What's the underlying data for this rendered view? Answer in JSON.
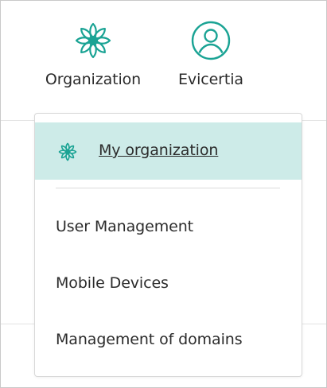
{
  "header": {
    "items": [
      {
        "label": "Organization",
        "icon": "lotus-icon"
      },
      {
        "label": "Evicertia",
        "icon": "user-circle-icon"
      }
    ]
  },
  "dropdown": {
    "highlighted": {
      "label": "My organization",
      "icon": "lotus-icon"
    },
    "items": [
      {
        "label": "User Management"
      },
      {
        "label": "Mobile Devices"
      },
      {
        "label": "Management of domains"
      }
    ]
  },
  "colors": {
    "accent": "#1aa394",
    "highlight_bg": "#cdebe8",
    "text": "#2b2b2b"
  }
}
